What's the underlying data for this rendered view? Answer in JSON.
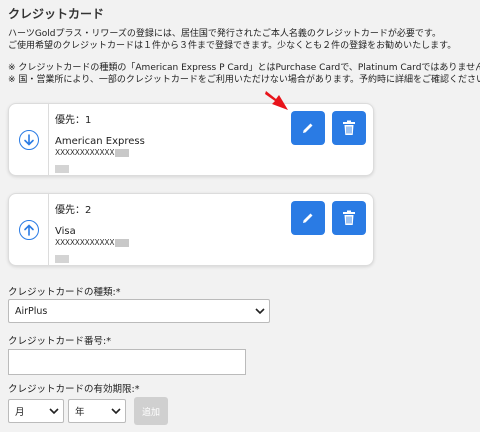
{
  "section": {
    "title": "クレジットカード",
    "intro_lines": [
      "ハーツGoldプラス・リワーズの登録には、居住国で発行されたご本人名義のクレジットカードが必要です。",
      "ご使用希望のクレジットカードは１件から３件まで登録できます。少なくとも２件の登録をお勧めいたします。"
    ],
    "note_lines": [
      "※ クレジットカードの種類の「American Express P Card」とはPurchase Cardで、Platinum Cardではありません。",
      "※ 国・営業所により、一部のクレジットカードをご利用いただけない場合があります。予約時に詳細をご確認ください。"
    ]
  },
  "cards": [
    {
      "priority": "優先：1",
      "brand": "American Express",
      "number": "XXXXXXXXXXXX",
      "arrow_icon": "arrow-down-circle-icon"
    },
    {
      "priority": "優先：2",
      "brand": "Visa",
      "number": "XXXXXXXXXXXX",
      "arrow_icon": "arrow-up-circle-icon"
    }
  ],
  "form": {
    "card_type_label": "クレジットカードの種類:*",
    "card_type_value": "AirPlus",
    "card_number_label": "クレジットカード番号:*",
    "card_number_value": "",
    "expiry_label": "クレジットカードの有効期限:*",
    "month_value": "月",
    "year_value": "年",
    "add_label": "追加"
  },
  "colors": {
    "accent": "#2a7be4",
    "disabled": "#d0d0d0",
    "highlight_arrow": "#e8141b"
  }
}
